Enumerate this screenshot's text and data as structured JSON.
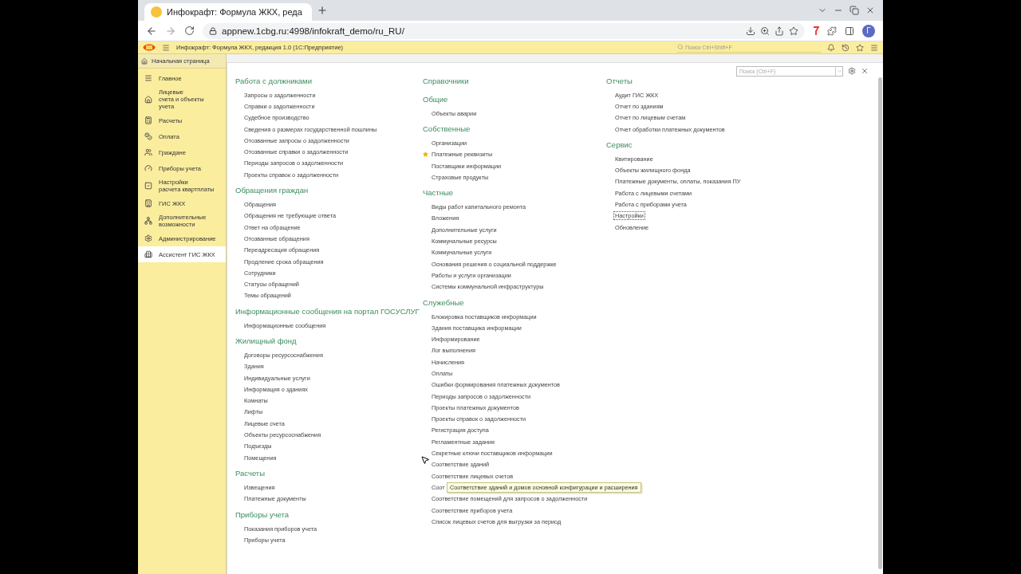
{
  "browser": {
    "tab_title": "Инфокрафт: Формула ЖКХ, реда",
    "url": "appnew.1cbg.ru:4998/infokraft_demo/ru_RU/",
    "profile_initial": "Г"
  },
  "app": {
    "title": "Инфокрафт: Формула ЖКХ, редакция 1.0  (1С:Предприятие)",
    "search": {
      "placeholder": "Поиск Ctrl+Shift+F"
    },
    "home_tab": "Начальная страница"
  },
  "sidebar": {
    "items": [
      {
        "label": "Главное",
        "selected": false
      },
      {
        "label": "Лицевые\nсчета и объекты учета",
        "selected": false
      },
      {
        "label": "Расчеты",
        "selected": false
      },
      {
        "label": "Оплата",
        "selected": false
      },
      {
        "label": "Граждане",
        "selected": false
      },
      {
        "label": "Приборы учета",
        "selected": false
      },
      {
        "label": "Настройки\nрасчета квартплаты",
        "selected": false
      },
      {
        "label": "ГИС ЖКХ",
        "selected": false
      },
      {
        "label": "Дополнительные\nвозможности",
        "selected": false
      },
      {
        "label": "Администрирование",
        "selected": false
      },
      {
        "label": "Ассистент ГИС ЖКХ",
        "selected": true
      }
    ]
  },
  "panel": {
    "search": {
      "placeholder": "Поиск (Ctrl+F)"
    },
    "columns": [
      {
        "groups": [
          {
            "title": "Работа с должниками",
            "items": [
              {
                "label": "Запросы о задолженности",
                "favorite": false,
                "focused": false
              },
              {
                "label": "Справки о задолженности",
                "favorite": false,
                "focused": false
              },
              {
                "label": "Судебное производство",
                "favorite": false,
                "focused": false
              },
              {
                "label": "Сведения о размерах государственной пошлины",
                "favorite": false,
                "focused": false
              },
              {
                "label": "Отозванные запросы о задолженности",
                "favorite": false,
                "focused": false
              },
              {
                "label": "Отозванные справки о задолженности",
                "favorite": false,
                "focused": false
              },
              {
                "label": "Периоды запросов о задолженности",
                "favorite": false,
                "focused": false
              },
              {
                "label": "Проекты справок о задолженности",
                "favorite": false,
                "focused": false
              }
            ]
          },
          {
            "title": "Обращения граждан",
            "items": [
              {
                "label": "Обращения",
                "favorite": false,
                "focused": false
              },
              {
                "label": "Обращения не требующие ответа",
                "favorite": false,
                "focused": false
              },
              {
                "label": "Ответ на обращение",
                "favorite": false,
                "focused": false
              },
              {
                "label": "Отозванные обращения",
                "favorite": false,
                "focused": false
              },
              {
                "label": "Переадресация обращения",
                "favorite": false,
                "focused": false
              },
              {
                "label": "Продление срока обращения",
                "favorite": false,
                "focused": false
              },
              {
                "label": "Сотрудники",
                "favorite": false,
                "focused": false
              },
              {
                "label": "Статусы обращений",
                "favorite": false,
                "focused": false
              },
              {
                "label": "Темы обращений",
                "favorite": false,
                "focused": false
              }
            ]
          },
          {
            "title": "Информационные сообщения на портал ГОСУСЛУГ",
            "items": [
              {
                "label": "Информационные сообщения",
                "favorite": false,
                "focused": false
              }
            ]
          },
          {
            "title": "Жилищный фонд",
            "items": [
              {
                "label": "Договоры ресурсоснабжения",
                "favorite": false,
                "focused": false
              },
              {
                "label": "Здания",
                "favorite": false,
                "focused": false
              },
              {
                "label": "Индивидуальные услуги",
                "favorite": false,
                "focused": false
              },
              {
                "label": "Информация о зданиях",
                "favorite": false,
                "focused": false
              },
              {
                "label": "Комнаты",
                "favorite": false,
                "focused": false
              },
              {
                "label": "Лифты",
                "favorite": false,
                "focused": false
              },
              {
                "label": "Лицевые счета",
                "favorite": false,
                "focused": false
              },
              {
                "label": "Объекты ресурсоснабжения",
                "favorite": false,
                "focused": false
              },
              {
                "label": "Подъезды",
                "favorite": false,
                "focused": false
              },
              {
                "label": "Помещения",
                "favorite": false,
                "focused": false
              }
            ]
          },
          {
            "title": "Расчеты",
            "items": [
              {
                "label": "Извещения",
                "favorite": false,
                "focused": false
              },
              {
                "label": "Платежные документы",
                "favorite": false,
                "focused": false
              }
            ]
          },
          {
            "title": "Приборы учета",
            "items": [
              {
                "label": "Показания приборов учета",
                "favorite": false,
                "focused": false
              },
              {
                "label": "Приборы учета",
                "favorite": false,
                "focused": false
              }
            ]
          }
        ]
      },
      {
        "groups": [
          {
            "title": "Справочники"
          },
          {
            "title": "Общие",
            "items": [
              {
                "label": "Объекты аварии",
                "favorite": false,
                "focused": false
              }
            ]
          },
          {
            "title": "Собственные",
            "items": [
              {
                "label": "Организации",
                "favorite": false,
                "focused": false
              },
              {
                "label": "Платежные реквизиты",
                "favorite": true,
                "focused": false
              },
              {
                "label": "Поставщики информации",
                "favorite": false,
                "focused": false
              },
              {
                "label": "Страховые продукты",
                "favorite": false,
                "focused": false
              }
            ]
          },
          {
            "title": "Частные",
            "items": [
              {
                "label": "Виды работ капитального ремонта",
                "favorite": false,
                "focused": false
              },
              {
                "label": "Вложения",
                "favorite": false,
                "focused": false
              },
              {
                "label": "Дополнительные услуги",
                "favorite": false,
                "focused": false
              },
              {
                "label": "Коммунальные ресурсы",
                "favorite": false,
                "focused": false
              },
              {
                "label": "Коммунальные услуги",
                "favorite": false,
                "focused": false
              },
              {
                "label": "Основания решения о социальной поддержке",
                "favorite": false,
                "focused": false
              },
              {
                "label": "Работы и услуги организации",
                "favorite": false,
                "focused": false
              },
              {
                "label": "Системы коммунальной инфраструктуры",
                "favorite": false,
                "focused": false
              }
            ]
          },
          {
            "title": "Служебные",
            "items": [
              {
                "label": "Блокировка поставщиков информации",
                "favorite": false,
                "focused": false
              },
              {
                "label": "Здания поставщика информации",
                "favorite": false,
                "focused": false
              },
              {
                "label": "Информирование",
                "favorite": false,
                "focused": false
              },
              {
                "label": "Лог выполнения",
                "favorite": false,
                "focused": false
              },
              {
                "label": "Начисления",
                "favorite": false,
                "focused": false
              },
              {
                "label": "Оплаты",
                "favorite": false,
                "focused": false
              },
              {
                "label": "Ошибки формирования платежных документов",
                "favorite": false,
                "focused": false
              },
              {
                "label": "Периоды запросов о задолженности",
                "favorite": false,
                "focused": false
              },
              {
                "label": "Проекты платежных документов",
                "favorite": false,
                "focused": false
              },
              {
                "label": "Проекты справок о задолженности",
                "favorite": false,
                "focused": false
              },
              {
                "label": "Регистрация доступа",
                "favorite": false,
                "focused": false
              },
              {
                "label": "Регламентные задания",
                "favorite": false,
                "focused": false
              },
              {
                "label": "Секретные ключи поставщиков информации",
                "favorite": false,
                "focused": false
              },
              {
                "label": "Соответствие зданий",
                "favorite": false,
                "focused": false
              },
              {
                "label": "Соответствие лицевых счетов",
                "favorite": false,
                "focused": false
              },
              {
                "label": "Соот",
                "favorite": false,
                "focused": false,
                "tooltip": "Соответствие зданий и домов основной конфигурации и расширения"
              },
              {
                "label": "Соответствие помещений для запросов о задолженности",
                "favorite": false,
                "focused": false
              },
              {
                "label": "Соответствие приборов учета",
                "favorite": false,
                "focused": false
              },
              {
                "label": "Список лицевых счетов для выгрузки за период",
                "favorite": false,
                "focused": false
              }
            ]
          }
        ]
      },
      {
        "groups": [
          {
            "title": "Отчеты",
            "items": [
              {
                "label": "Аудит ГИС ЖКХ",
                "favorite": false,
                "focused": false
              },
              {
                "label": "Отчет по зданиям",
                "favorite": false,
                "focused": false
              },
              {
                "label": "Отчет по лицевым счетам",
                "favorite": false,
                "focused": false
              },
              {
                "label": "Отчет обработки платежных документов",
                "favorite": false,
                "focused": false
              }
            ]
          },
          {
            "title": "Сервис",
            "items": [
              {
                "label": "Квитирование",
                "favorite": false,
                "focused": false
              },
              {
                "label": "Объекты жилищного фонда",
                "favorite": false,
                "focused": false
              },
              {
                "label": "Платежные документы, оплаты, показания ПУ",
                "favorite": false,
                "focused": false
              },
              {
                "label": "Работа с лицевыми счетами",
                "favorite": false,
                "focused": false
              },
              {
                "label": "Работа с приборами учета",
                "favorite": false,
                "focused": false
              },
              {
                "label": "Настройки",
                "favorite": false,
                "focused": true
              },
              {
                "label": "Обновление",
                "favorite": false,
                "focused": false
              }
            ]
          }
        ]
      }
    ]
  }
}
